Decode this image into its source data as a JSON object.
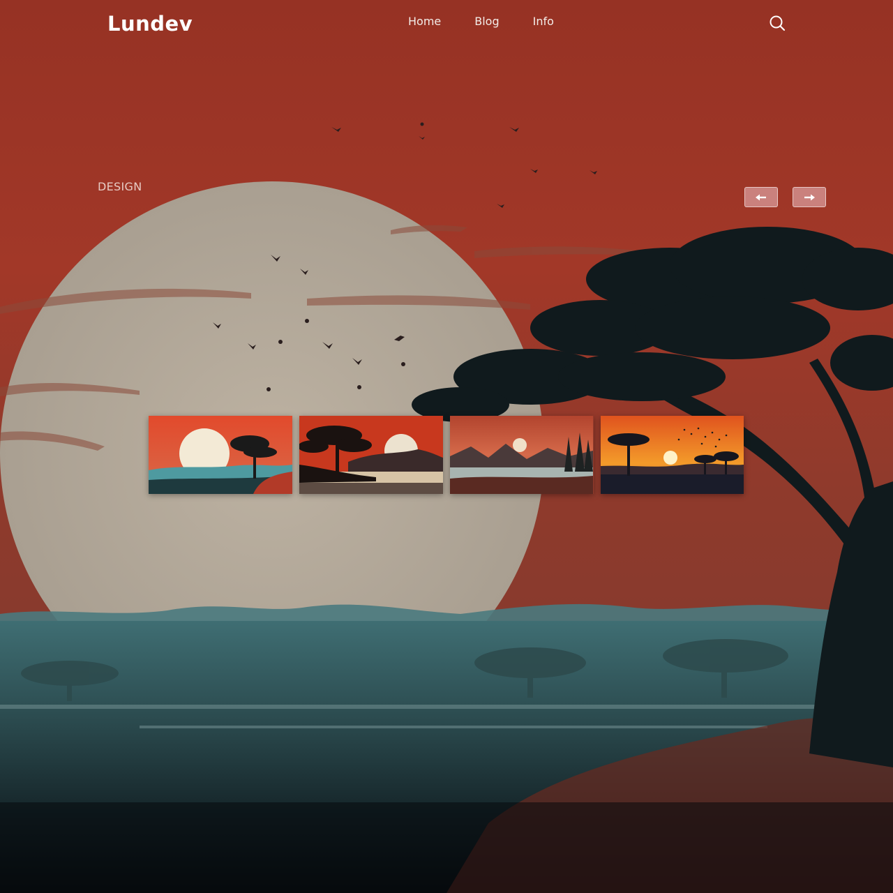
{
  "header": {
    "logo": "Lundev",
    "nav": [
      "Home",
      "Blog",
      "Info"
    ]
  },
  "hero": {
    "category": "DESIGN"
  },
  "slider": {
    "thumbnails": [
      "sunset-tree-teal-landscape",
      "sunset-lake-tree-red-sky",
      "mountain-lake-pine-forest",
      "savanna-orange-sunset-birds"
    ]
  },
  "icons": {
    "search": "search-icon",
    "prev": "arrow-left-icon",
    "next": "arrow-right-icon"
  },
  "colors": {
    "sky": "#9a3526",
    "moon": "#b8ad9d",
    "teal": "#3e6e72",
    "dark": "#0c1518",
    "button_bg": "#d69696"
  }
}
